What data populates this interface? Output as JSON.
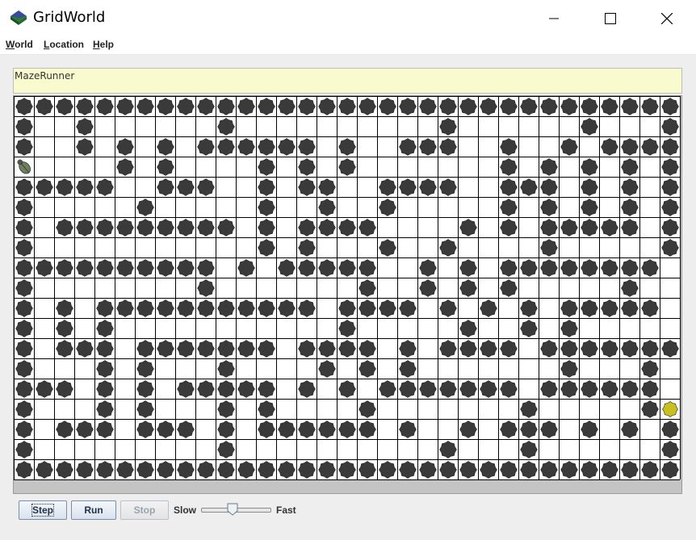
{
  "window": {
    "title": "GridWorld",
    "icon": "gridworld-diamond-icon",
    "controls": [
      "minimize-icon",
      "maximize-icon",
      "close-icon"
    ]
  },
  "menu": [
    {
      "label": "World"
    },
    {
      "label": "Location"
    },
    {
      "label": "Help"
    }
  ],
  "message": "MazeRunner",
  "grid": {
    "rows": 19,
    "cols": 33,
    "cell_types": {
      "#": "rock",
      ".": "empty",
      "B": "bug",
      "F": "flower"
    },
    "colors": {
      "rock": "#3a3a3a",
      "bug": "#6f7f60",
      "flower": "#c8c020",
      "grid_line": "#000000",
      "cell": "#ffffff"
    },
    "cells": [
      "#################################",
      "#..#......#..........#......#...#",
      "#..#.#.#.######.#..###..#..#.####",
      "B....#.#....#.#.#.......#.#.#.#.#",
      "#####..###..#.##..####..###.#.#.#",
      "#.....#.....#..#..#.....#.#.#.#.#",
      "#.#########.#.####....#.#.#####.#",
      "#...........#.#...#..#....#.....#",
      "##########.#.#####..#.#.########.#",
      "#........#.......#..#.#.#.....#..#",
      "#.#.###########.####.#.#.#.#####.#",
      "#.#.#...........#.....#..#.#.....#",
      "#.###.#######.####.#.####.#######.#",
      "#...#.#...#....#.#.#.......#...#.#",
      "###.#.#.#####.#.#.#######.######.#",
      "#...#.#...#.#....#.......#.....#F",
      "#.###.###.#.######.#..#.###.#.#.#",
      "#.........#..........#...#......#",
      "#################################"
    ]
  },
  "controls": {
    "step": "Step",
    "run": "Run",
    "stop": "Stop",
    "slow": "Slow",
    "fast": "Fast",
    "speed": 0.45
  }
}
